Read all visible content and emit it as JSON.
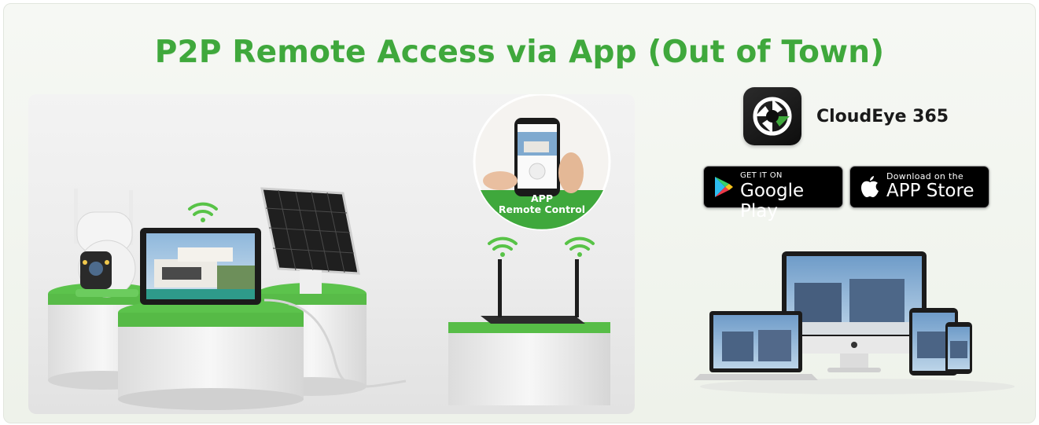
{
  "title": "P2P Remote Access via App (Out of Town)",
  "callout": {
    "line1": "APP",
    "line2": "Remote Control"
  },
  "app": {
    "name": "CloudEye 365",
    "icon": "aperture-app-icon"
  },
  "store_badges": [
    {
      "small": "GET IT ON",
      "big": "Google Play",
      "icon": "google-play-icon"
    },
    {
      "small": "Download on the",
      "big": "APP Store",
      "icon": "apple-icon"
    }
  ],
  "colors": {
    "accent": "#3fa83c",
    "pedestal_green": "#5cc34c",
    "badge_bg": "#000000"
  }
}
